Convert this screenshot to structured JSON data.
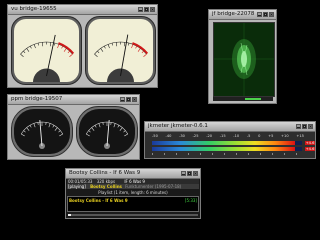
{
  "windows": {
    "vu": {
      "title": "vu bridge-19655"
    },
    "jf": {
      "title": "jf bridge-22078"
    },
    "ppm": {
      "title": "ppm bridge-19507"
    },
    "jkmeter": {
      "title": "jkmeter   jkmeter-0.6.1"
    },
    "player": {
      "title": "Bootsy Collins - If 6 Was 9"
    }
  },
  "meters": {
    "vu_left_level": 0.62,
    "vu_right_level": 0.6,
    "ppm_left_level": 0.46,
    "ppm_right_level": 0.54
  },
  "jkmeter": {
    "scale": [
      "-50",
      "-40",
      "-30",
      "-25",
      "-20",
      "-15",
      "-10",
      "-5",
      "0",
      "+5",
      "+10",
      "+15"
    ],
    "peak_label": "+4.6",
    "levels": {
      "left": 0.95,
      "right": 0.95
    }
  },
  "player": {
    "time": "00:01/05:33",
    "format": "320 kbps",
    "track_header": "IF 6 Was 9",
    "status": "[playing]",
    "now_playing": "Bootsy Collins",
    "album": "Funkturnerder (1995-07-18)",
    "playlist_label": "Playlist (1 item, length: 6 minutes)",
    "playlist_item": "Bootsy Collins - If 6 Was 9",
    "playlist_duration": "[5:33]",
    "progress": 0.02
  },
  "colors": {
    "vu_face": "#f1efd6",
    "ppm_face": "#141414",
    "jf_display": "#0a2c0a",
    "accent_red": "#d01818",
    "player_yellow": "#e8d020"
  }
}
